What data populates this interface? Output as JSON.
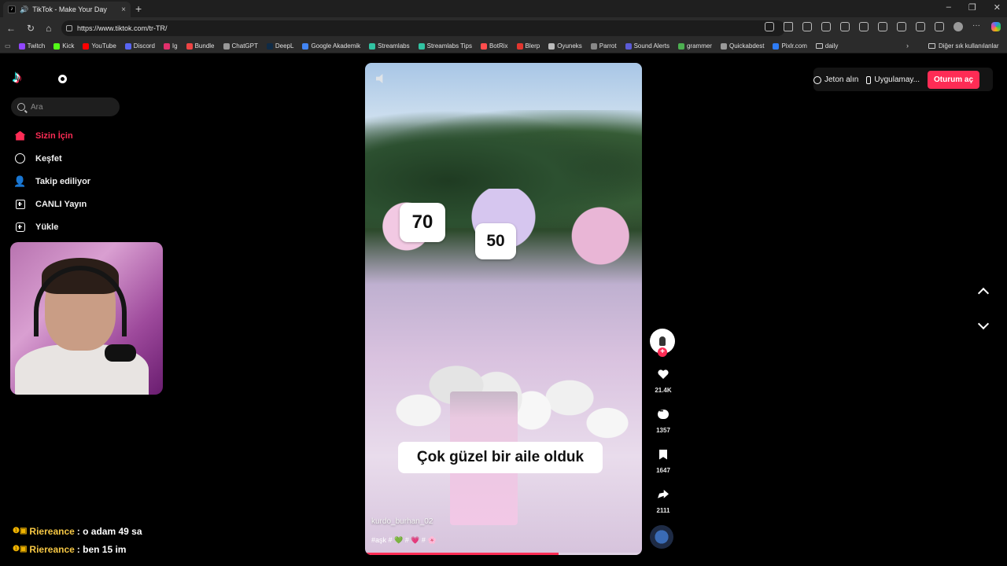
{
  "browser": {
    "tab_title": "TikTok - Make Your Day",
    "tab_close": "×",
    "new_tab": "+",
    "url": "https://www.tiktok.com/tr-TR/",
    "window_controls": [
      "–",
      "❐",
      "✕"
    ]
  },
  "bookmarks": [
    {
      "label": "Twitch",
      "color": "#9146ff"
    },
    {
      "label": "Kick",
      "color": "#53fc18"
    },
    {
      "label": "YouTube",
      "color": "#ff0000"
    },
    {
      "label": "Discord",
      "color": "#5865f2"
    },
    {
      "label": "Ig",
      "color": "#e1306c"
    },
    {
      "label": "Bundle",
      "color": "#e44"
    },
    {
      "label": "ChatGPT",
      "color": "#999"
    },
    {
      "label": "DeepL",
      "color": "#0f2b46"
    },
    {
      "label": "Google Akademik",
      "color": "#4285f4"
    },
    {
      "label": "Streamlabs",
      "color": "#31c3a2"
    },
    {
      "label": "Streamlabs Tips",
      "color": "#31c3a2"
    },
    {
      "label": "BotRix",
      "color": "#ff4d4d"
    },
    {
      "label": "Blerp",
      "color": "#e3362f"
    },
    {
      "label": "Oyuneks",
      "color": "#bbb"
    },
    {
      "label": "Parrot",
      "color": "#888"
    },
    {
      "label": "Sound Alerts",
      "color": "#5b5bd6"
    },
    {
      "label": "grammer",
      "color": "#4caf50"
    },
    {
      "label": "Quickabdest",
      "color": "#999"
    },
    {
      "label": "Pixlr.com",
      "color": "#2e7cf6"
    },
    {
      "label": "daily",
      "color": "folder"
    }
  ],
  "bookmarks_more": "›",
  "bookmarks_other": "Diğer sık kullanılanlar",
  "search": {
    "placeholder": "Ara"
  },
  "menu": [
    {
      "label": "Sizin İçin",
      "active": true,
      "icon": "home-icon"
    },
    {
      "label": "Keşfet",
      "active": false,
      "icon": "compass-icon"
    },
    {
      "label": "Takip ediliyor",
      "active": false,
      "icon": "following-icon"
    },
    {
      "label": "CANLI Yayın",
      "active": false,
      "icon": "live-icon"
    },
    {
      "label": "Yükle",
      "active": false,
      "icon": "upload-icon"
    }
  ],
  "chat": [
    {
      "user": "Riereance",
      "message": ": o adam 49 sa"
    },
    {
      "user": "Riereance",
      "message": ": ben 15 im"
    }
  ],
  "chat_badges": "❶▣",
  "video": {
    "age_left": "70",
    "age_right": "50",
    "caption": "Çok güzel bir aile olduk",
    "author": "kurdo_burhan_02",
    "tags": "#aşk # 💚 # 💗 # 🌸",
    "progress": 0.7
  },
  "actions": {
    "likes": "21.4K",
    "comments": "1357",
    "saves": "1647",
    "shares": "2111",
    "follow": "+"
  },
  "topbar": {
    "coins": "Jeton alın",
    "app": "Uygulamay...",
    "login": "Oturum aç"
  },
  "colors": {
    "brand": "#fe2c55",
    "chat_user": "#f6c744"
  }
}
